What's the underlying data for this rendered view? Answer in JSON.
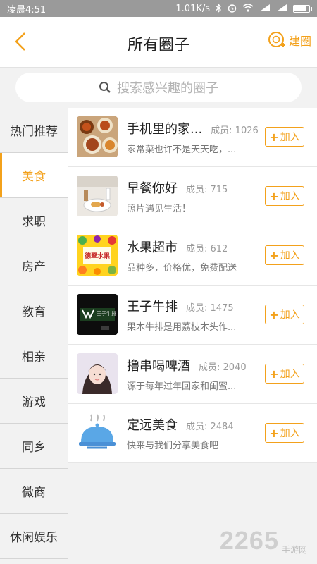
{
  "status_bar": {
    "time": "凌晨4:51",
    "network_speed": "1.01K/s",
    "icons": [
      "bluetooth-icon",
      "alarm-icon",
      "wifi-icon",
      "signal-icon",
      "signal-icon",
      "battery-icon"
    ]
  },
  "header": {
    "title": "所有圈子",
    "create_label": "建圈",
    "back_icon": "chevron-left-icon",
    "create_icon": "add-circle-icon"
  },
  "search": {
    "placeholder": "搜索感兴趣的圈子",
    "icon": "search-icon"
  },
  "sidebar": {
    "items": [
      {
        "label": "热门推荐",
        "active": false
      },
      {
        "label": "美食",
        "active": true
      },
      {
        "label": "求职",
        "active": false
      },
      {
        "label": "房产",
        "active": false
      },
      {
        "label": "教育",
        "active": false
      },
      {
        "label": "相亲",
        "active": false
      },
      {
        "label": "游戏",
        "active": false
      },
      {
        "label": "同乡",
        "active": false
      },
      {
        "label": "微商",
        "active": false
      },
      {
        "label": "休闲娱乐",
        "active": false
      }
    ]
  },
  "groups": [
    {
      "name": "手机里的家...",
      "members": "成员: 1026",
      "desc": "家常菜也许不是天天吃，...",
      "join": "加入",
      "thumb": "food-platter"
    },
    {
      "name": "早餐你好",
      "members": "成员: 715",
      "desc": "照片遇见生活！",
      "join": "加入",
      "thumb": "breakfast"
    },
    {
      "name": "水果超市",
      "members": "成员: 612",
      "desc": "品种多，价格优，免费配送",
      "join": "加入",
      "thumb": "fruit-logo",
      "thumb_text": "德翠水果"
    },
    {
      "name": "王子牛排",
      "members": "成员: 1475",
      "desc": "果木牛排是用荔枝木头作...",
      "join": "加入",
      "thumb": "steak-logo",
      "thumb_text": "王子牛排"
    },
    {
      "name": "撸串喝啤酒",
      "members": "成员: 2040",
      "desc": "源于每年过年回家和闺蜜...",
      "join": "加入",
      "thumb": "portrait"
    },
    {
      "name": "定远美食",
      "members": "成员: 2484",
      "desc": "快来与我们分享美食吧",
      "join": "加入",
      "thumb": "cloche-icon"
    }
  ],
  "watermark": {
    "number": "2265",
    "text": "手游网"
  },
  "colors": {
    "accent": "#f3a11b",
    "status_bar": "#9a9a9a",
    "background": "#f2f2f2"
  }
}
